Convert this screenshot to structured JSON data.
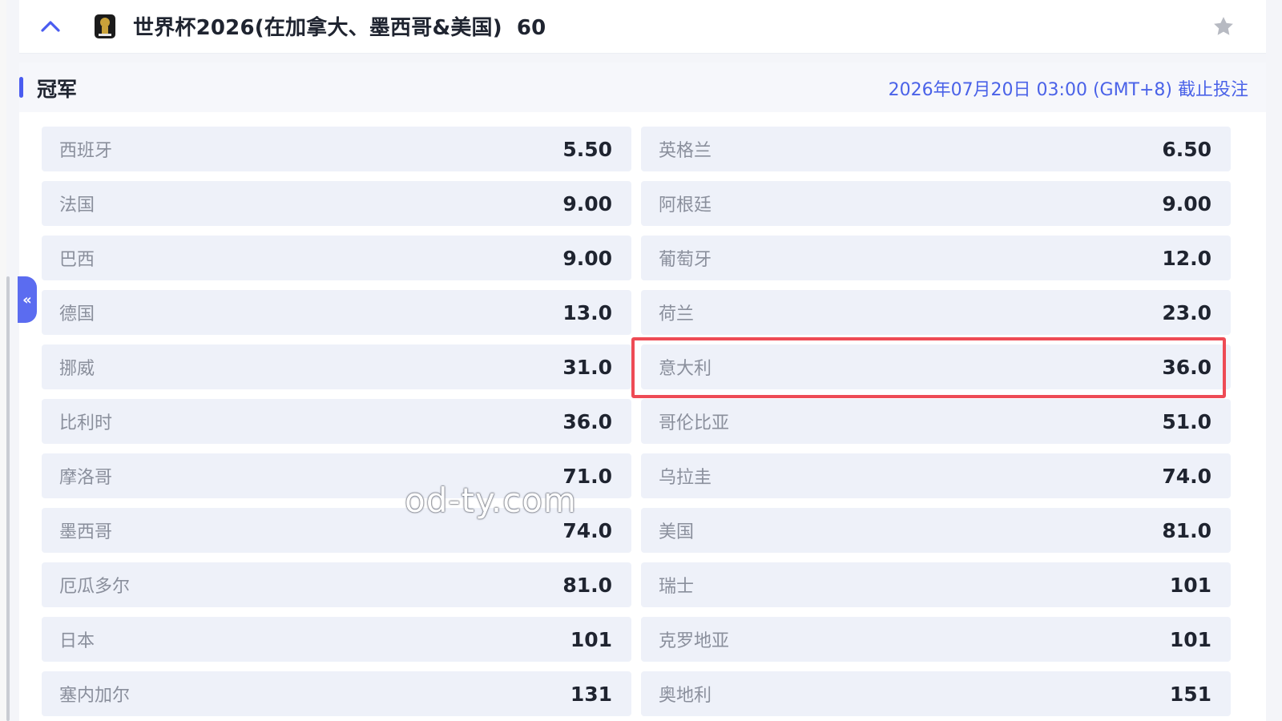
{
  "header": {
    "title": "世界杯2026(在加拿大、墨西哥&美国)",
    "count": "60"
  },
  "market": {
    "title": "冠军",
    "deadline": "2026年07月20日 03:00 (GMT+8) 截止投注"
  },
  "side_toggle": {
    "label": "«"
  },
  "teams": [
    {
      "name": "西班牙",
      "odds": "5.50"
    },
    {
      "name": "英格兰",
      "odds": "6.50"
    },
    {
      "name": "法国",
      "odds": "9.00"
    },
    {
      "name": "阿根廷",
      "odds": "9.00"
    },
    {
      "name": "巴西",
      "odds": "9.00"
    },
    {
      "name": "葡萄牙",
      "odds": "12.0"
    },
    {
      "name": "德国",
      "odds": "13.0"
    },
    {
      "name": "荷兰",
      "odds": "23.0"
    },
    {
      "name": "挪威",
      "odds": "31.0"
    },
    {
      "name": "意大利",
      "odds": "36.0"
    },
    {
      "name": "比利时",
      "odds": "36.0"
    },
    {
      "name": "哥伦比亚",
      "odds": "51.0"
    },
    {
      "name": "摩洛哥",
      "odds": "71.0"
    },
    {
      "name": "乌拉圭",
      "odds": "74.0"
    },
    {
      "name": "墨西哥",
      "odds": "74.0"
    },
    {
      "name": "美国",
      "odds": "81.0"
    },
    {
      "name": "厄瓜多尔",
      "odds": "81.0"
    },
    {
      "name": "瑞士",
      "odds": "101"
    },
    {
      "name": "日本",
      "odds": "101"
    },
    {
      "name": "克罗地亚",
      "odds": "101"
    },
    {
      "name": "塞内加尔",
      "odds": "131"
    },
    {
      "name": "奥地利",
      "odds": "151"
    }
  ],
  "watermark": "od-ty.com",
  "colors": {
    "accent": "#4a5cf0",
    "highlight": "#ee4b55",
    "cell_bg": "#eef1f9"
  }
}
